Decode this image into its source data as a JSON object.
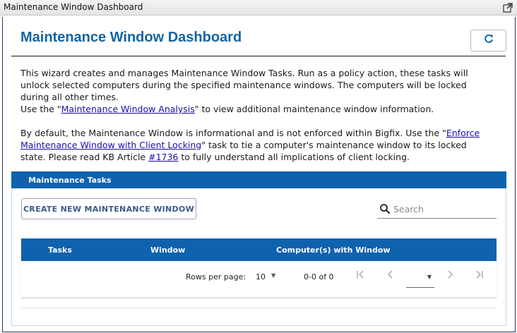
{
  "window": {
    "title": "Maintenance Window Dashboard",
    "popout_icon": "popout-icon"
  },
  "header": {
    "title": "Maintenance Window Dashboard",
    "refresh_icon": "refresh-icon"
  },
  "intro": {
    "p1": "This wizard creates and manages Maintenance Window Tasks. Run as a policy action, these tasks will unlock selected computers during the specified maintenance windows. The computers will be locked during all other times.",
    "p2_before": "Use the \"",
    "p2_link": "Maintenance Window Analysis",
    "p2_after": "\" to view additional maintenance window information.",
    "p3_before": "By default, the Maintenance Window is informational and is not enforced within Bigfix. Use the \"",
    "p3_link": "Enforce Maintenance Window with Client Locking",
    "p3_middle": "\" task to tie a computer's maintenance window to its locked state. Please read KB Article ",
    "p3_kb_link": "#1736",
    "p3_after": " to fully understand all implications of client locking."
  },
  "panel": {
    "title": "Maintenance Tasks",
    "create_button": "CREATE NEW MAINTENANCE WINDOW",
    "search": {
      "placeholder": "Search",
      "value": "",
      "icon": "search-icon"
    },
    "table": {
      "columns": [
        "Tasks",
        "Window",
        "Computer(s) with Window"
      ],
      "rows": []
    },
    "pagination": {
      "rows_per_page_label": "Rows per page:",
      "rows_per_page": "10",
      "range": "0-0 of 0",
      "page_value": "",
      "first_icon": "first-page-icon",
      "prev_icon": "prev-page-icon",
      "next_icon": "next-page-icon",
      "last_icon": "last-page-icon"
    }
  },
  "colors": {
    "title_blue": "#1264a3",
    "header_blue": "#0f62ad",
    "link": "#1a0dab"
  }
}
